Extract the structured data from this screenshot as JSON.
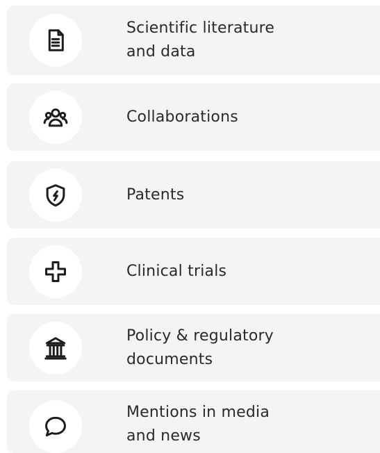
{
  "items": [
    {
      "label": "Scientific literature\nand data",
      "icon": "document-icon"
    },
    {
      "label": "Collaborations",
      "icon": "people-group-icon"
    },
    {
      "label": "Patents",
      "icon": "shield-icon"
    },
    {
      "label": "Clinical trials",
      "icon": "medical-cross-icon"
    },
    {
      "label": "Policy & regulatory\ndocuments",
      "icon": "government-building-icon"
    },
    {
      "label": "Mentions in media\nand news",
      "icon": "speech-bubble-icon"
    }
  ],
  "colors": {
    "row_background": "#f4f4f4",
    "icon_circle": "#ffffff",
    "text": "#2a2a2a"
  }
}
